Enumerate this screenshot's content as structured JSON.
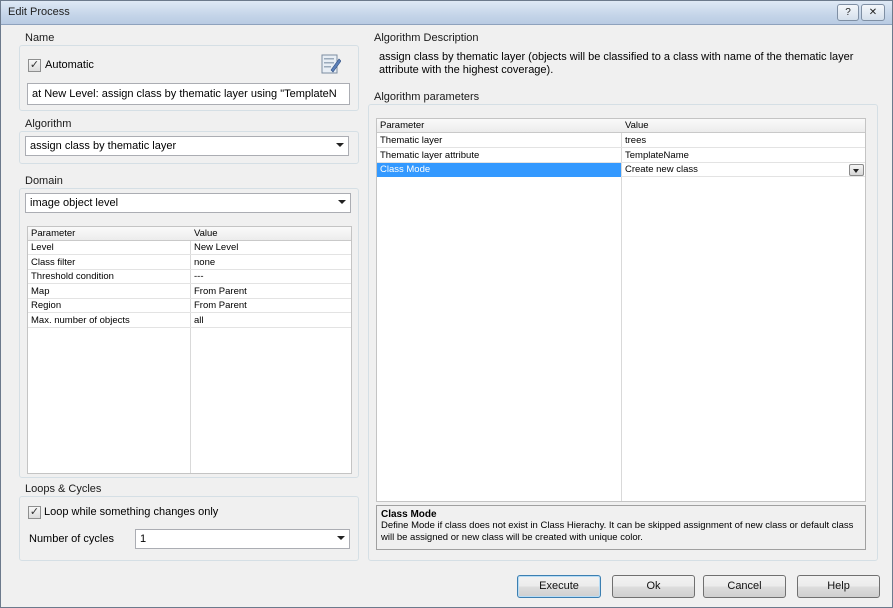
{
  "window": {
    "title": "Edit Process",
    "help_label": "?",
    "close_label": "✕"
  },
  "name_group": {
    "title": "Name",
    "automatic_label": "Automatic",
    "automatic_checked": true,
    "name_value": "at  New Level: assign class by thematic layer using \"TemplateN"
  },
  "algorithm_group": {
    "title": "Algorithm",
    "selected": "assign class by thematic layer"
  },
  "domain_group": {
    "title": "Domain",
    "selected": "image object level",
    "grid_headers": [
      "Parameter",
      "Value"
    ],
    "rows": [
      {
        "param": "Level",
        "value": "New Level"
      },
      {
        "param": "Class filter",
        "value": "none"
      },
      {
        "param": "Threshold condition",
        "value": "---"
      },
      {
        "param": "Map",
        "value": "From Parent"
      },
      {
        "param": "Region",
        "value": "From Parent"
      },
      {
        "param": "Max. number of objects",
        "value": "all"
      }
    ]
  },
  "loops_group": {
    "title": "Loops & Cycles",
    "loop_label": "Loop while something changes only",
    "loop_checked": true,
    "cycles_label": "Number of cycles",
    "cycles_value": "1"
  },
  "algorithm_description": {
    "title": "Algorithm Description",
    "text": "assign class by thematic layer (objects will be classified to a class with name of the thematic layer attribute with the highest coverage)."
  },
  "algorithm_parameters": {
    "title": "Algorithm parameters",
    "grid_headers": [
      "Parameter",
      "Value"
    ],
    "rows": [
      {
        "param": "Thematic layer",
        "value": "trees"
      },
      {
        "param": "Thematic layer attribute",
        "value": "TemplateName"
      },
      {
        "param": "Class Mode",
        "value": "Create new class"
      }
    ],
    "selected_row": 2,
    "help_title": "Class Mode",
    "help_text": "Define Mode if class does not exist in Class Hierachy. It can be skipped assignment of new class or default class will be assigned or new class will be created with unique color."
  },
  "buttons": {
    "execute": "Execute",
    "ok": "Ok",
    "cancel": "Cancel",
    "help": "Help"
  }
}
